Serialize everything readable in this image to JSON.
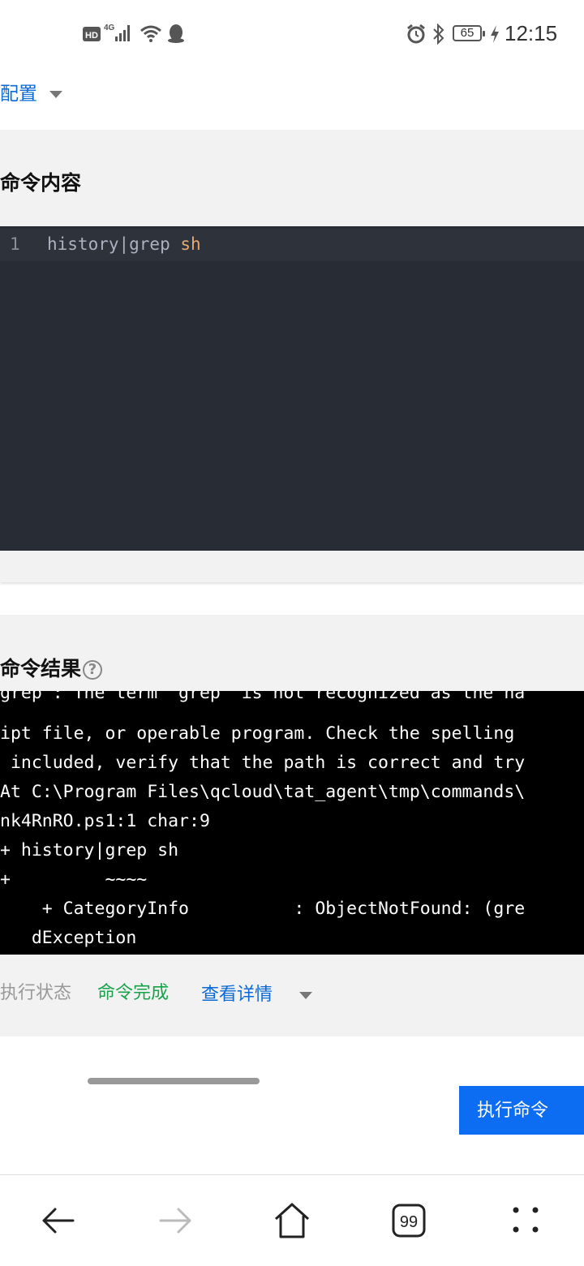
{
  "status_bar": {
    "network_badge": "HD",
    "network_type": "4G",
    "battery": "65",
    "time": "12:15",
    "icons": [
      "hd-icon",
      "signal-icon",
      "wifi-icon",
      "qq-icon",
      "alarm-icon",
      "bluetooth-icon",
      "battery-icon",
      "charging-icon"
    ]
  },
  "header": {
    "config_label": "配置"
  },
  "command_section": {
    "title": "命令内容",
    "editor": {
      "line_number": "1",
      "code_plain": "history|grep ",
      "code_highlight": "sh"
    }
  },
  "result_section": {
    "title": "命令结果",
    "output_lines": [
      "grep : The term 'grep' is not recognized as the na",
      "ipt file, or operable program. Check the spelling",
      " included, verify that the path is correct and try",
      "At C:\\Program Files\\qcloud\\tat_agent\\tmp\\commands\\",
      "nk4RnRO.ps1:1 char:9",
      "+ history|grep sh",
      "+         ~~~~",
      "    + CategoryInfo          : ObjectNotFound: (gre",
      "   dException"
    ],
    "status_label": "执行状态",
    "status_value": "命令完成",
    "detail_link": "查看详情"
  },
  "actions": {
    "execute_label": "执行命令"
  },
  "bottom_nav": [
    "back-icon",
    "forward-icon",
    "home-icon",
    "tabs-icon",
    "more-icon"
  ],
  "tabs_count": "99",
  "colors": {
    "link_blue": "#0b6ad6",
    "success_green": "#17a34a",
    "button_blue": "#0c6cf2",
    "editor_bg": "#282c34",
    "terminal_bg": "#000000"
  }
}
